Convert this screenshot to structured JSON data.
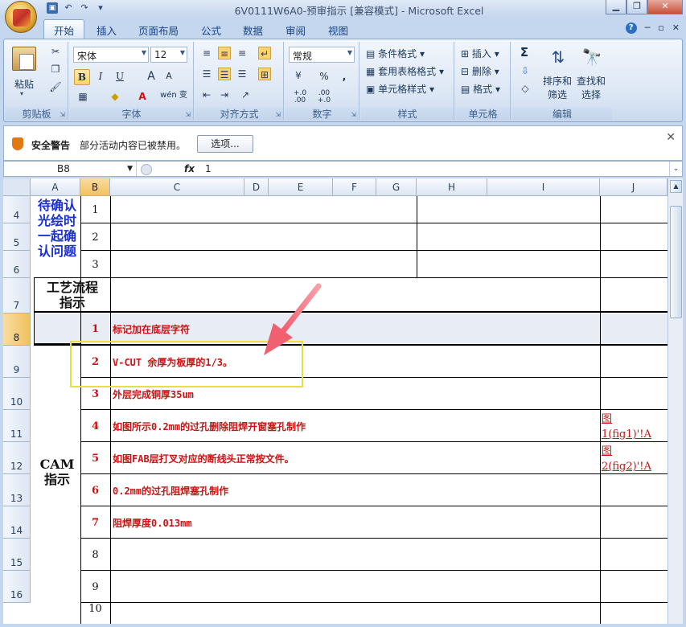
{
  "window": {
    "title": "6V0111W6A0-预审指示  [兼容模式]  -  Microsoft Excel",
    "min_icon": "minimize-icon",
    "max_icon": "restore-icon",
    "close_icon": "close-icon"
  },
  "qat": {
    "undo_label": "↶",
    "redo_label": "↷",
    "more_label": "▾"
  },
  "tabs": [
    "开始",
    "插入",
    "页面布局",
    "公式",
    "数据",
    "审阅",
    "视图"
  ],
  "active_tab": "开始",
  "ribbon": {
    "clipboard": {
      "group": "剪贴板",
      "paste": "粘贴"
    },
    "font": {
      "group": "字体",
      "name": "宋体",
      "size": "12",
      "bold": "B",
      "italic": "I",
      "underline": "U",
      "grow": "A",
      "shrink": "A",
      "phonetic": "wén 变"
    },
    "alignment": {
      "group": "对齐方式"
    },
    "number": {
      "group": "数字",
      "format": "常规",
      "percent": "%",
      "comma": ",",
      "inc_dec": "+.0 .00",
      "dec_dec": ".00 +.0"
    },
    "styles": {
      "group": "样式",
      "cond": "条件格式",
      "table": "套用表格格式",
      "cell": "单元格样式"
    },
    "cells": {
      "group": "单元格",
      "insert": "插入",
      "delete": "删除",
      "format": "格式"
    },
    "editing": {
      "group": "编辑",
      "sum": "Σ",
      "sort": "排序和\n筛选",
      "find": "查找和\n选择",
      "sort_line1": "排序和",
      "sort_line2": "筛选",
      "find_line1": "查找和",
      "find_line2": "选择"
    }
  },
  "security": {
    "title": "安全警告",
    "message": "部分活动内容已被禁用。",
    "options": "选项..."
  },
  "formula_bar": {
    "name_box": "B8",
    "fx": "fx",
    "value": "1"
  },
  "columns": [
    "A",
    "B",
    "C",
    "D",
    "E",
    "F",
    "G",
    "H",
    "I",
    "J"
  ],
  "selected_column": "B",
  "rows": [
    "4",
    "5",
    "6",
    "7",
    "8",
    "9",
    "10",
    "11",
    "12",
    "13",
    "14",
    "15",
    "16"
  ],
  "selected_row": "8",
  "sheet": {
    "pending": "待确认光绘时一起确认问题",
    "pending_lines": [
      "待确认",
      "光绘时",
      "一起确",
      "认问题"
    ],
    "pending_items": [
      "1",
      "2",
      "3"
    ],
    "process_title_lines": [
      "工艺流程",
      "指示"
    ],
    "cam_lines": [
      "CAM",
      "指示"
    ],
    "cam_items": [
      {
        "no": "1",
        "text": "标记加在底层字符"
      },
      {
        "no": "2",
        "text": "V-CUT 余厚为板厚的1/3。"
      },
      {
        "no": "3",
        "text": "外层完成铜厚35um"
      },
      {
        "no": "4",
        "text": "如图所示0.2mm的过孔删除阻焊开窗塞孔制作",
        "link": "图\n1(fig1)'!A",
        "link_l1": "图",
        "link_l2": "1(fig1)'!A"
      },
      {
        "no": "5",
        "text": "如图FAB层打叉对应的断线头正常按文件。",
        "link": "图\n2(fig2)'!A",
        "link_l1": "图",
        "link_l2": "2(fig2)'!A"
      },
      {
        "no": "6",
        "text": "0.2mm的过孔阻焊塞孔制作"
      },
      {
        "no": "7",
        "text": "阻焊厚度0.013mm"
      },
      {
        "no": "8",
        "text": ""
      },
      {
        "no": "9",
        "text": ""
      },
      {
        "no": "10",
        "text": ""
      }
    ]
  },
  "colors": {
    "ribbon": "#dbe6f4",
    "instruction_red": "#d01010",
    "pending_blue": "#1a2fd0",
    "highlight_yellow": "#e8e040",
    "arrow_pink": "#f06070"
  }
}
